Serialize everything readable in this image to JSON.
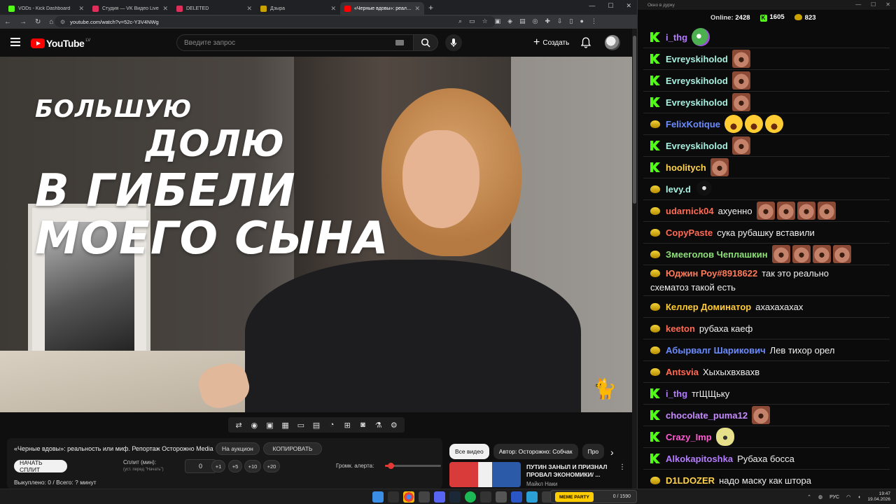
{
  "browser": {
    "tabs": [
      {
        "title": "VODs - Kick Dashboard",
        "color": "#53fc18"
      },
      {
        "title": "Студия — VK Видео Live",
        "color": "#e02e5a"
      },
      {
        "title": "DELETED",
        "color": "#e02e5a"
      },
      {
        "title": "Дзыра",
        "color": "#c9a200"
      },
      {
        "title": "«Черные вдовы»: реальн...",
        "color": "#ff0000",
        "active": true
      }
    ],
    "url": "youtube.com/watch?v=52c-Y3V4NWg"
  },
  "youtube": {
    "logo_text": "YouTube",
    "country": "LV",
    "search_placeholder": "Введите запрос",
    "create_label": "Создать"
  },
  "video": {
    "overlay_lines": [
      "БОЛЬШУЮ",
      "ДОЛЮ",
      "В ГИБЕЛИ",
      "МОЕГО СЫНА"
    ]
  },
  "panel": {
    "video_title": "«Черные вдовы»: реальность или миф. Репортаж Осторожно Media",
    "auction_label": "На аукцион",
    "copy_label": "КОПИРОВАТЬ",
    "start_split_label": "НАЧАТЬ СПЛИТ",
    "split_label": "Сплит (мин):",
    "split_hint": "(уст. перед \"Начать\")",
    "split_value": "0",
    "increments": [
      "+1",
      "+5",
      "+10",
      "+20"
    ],
    "volume_label": "Громк. алерта:",
    "volume_level": 0.1,
    "status": "Выкуплено: 0 / Всего: ? минут"
  },
  "related": {
    "chips": [
      {
        "label": "Все видео",
        "active": true
      },
      {
        "label": "Автор: Осторожно: Собчак",
        "active": false
      },
      {
        "label": "Про",
        "active": false
      }
    ],
    "items": [
      {
        "title": "ПУТИН ЗАНЫЛ И ПРИЗНАЛ ПРОВАЛ ЭКОНОМИКИ/ ...",
        "channel": "Майкл Наки"
      }
    ]
  },
  "chat": {
    "window_title": "Окно в дурку",
    "online_label": "Online:",
    "online_count": "2428",
    "kick_count": "1605",
    "vk_count": "823",
    "messages": [
      {
        "platform": "kick",
        "nick": "i_thg",
        "color": "#b47cff",
        "text": "",
        "emotes": [
          "frog"
        ]
      },
      {
        "platform": "kick",
        "nick": "Evreyskiholod",
        "color": "#a8f0e0",
        "text": "",
        "emotes": [
          "face"
        ]
      },
      {
        "platform": "kick",
        "nick": "Evreyskiholod",
        "color": "#a8f0e0",
        "text": "",
        "emotes": [
          "face"
        ]
      },
      {
        "platform": "kick",
        "nick": "Evreyskiholod",
        "color": "#a8f0e0",
        "text": "",
        "emotes": [
          "face"
        ]
      },
      {
        "platform": "vk",
        "nick": "FelixKotique",
        "color": "#6a8cff",
        "text": "",
        "emotes": [
          "laugh",
          "laugh",
          "laugh"
        ]
      },
      {
        "platform": "kick",
        "nick": "Evreyskiholod",
        "color": "#a8f0e0",
        "text": "",
        "emotes": [
          "face"
        ]
      },
      {
        "platform": "kick",
        "nick": "hoolitych",
        "color": "#ffd24d",
        "text": "",
        "emotes": [
          "face"
        ]
      },
      {
        "platform": "vk",
        "nick": "levy.d",
        "color": "#a8f0e0",
        "text": "",
        "emotes": [
          "cat"
        ]
      },
      {
        "platform": "vk",
        "nick": "udarnick04",
        "color": "#ff6a55",
        "text": "ахуенно",
        "emotes": [
          "face",
          "face",
          "face",
          "face"
        ]
      },
      {
        "platform": "vk",
        "nick": "CopyPaste",
        "color": "#ff6a55",
        "text": "сука рубашку вставили",
        "emotes": []
      },
      {
        "platform": "vk",
        "nick": "Змееголов Чеплашкин",
        "color": "#8fe07a",
        "text": "",
        "emotes": [
          "face",
          "face",
          "face",
          "face"
        ]
      },
      {
        "platform": "vk",
        "nick": "Юджин Роу#8918622",
        "color": "#ff7a5a",
        "text": "так это реально",
        "text2": "схематоз такой есть",
        "emotes": []
      },
      {
        "platform": "vk",
        "nick": "Келлер Доминатор",
        "color": "#ffcc33",
        "text": "ахахахахах",
        "emotes": []
      },
      {
        "platform": "vk",
        "nick": "keeton",
        "color": "#ff6a55",
        "text": "рубаха каеф",
        "emotes": []
      },
      {
        "platform": "vk",
        "nick": "Абырвалг Шарикович",
        "color": "#6a8cff",
        "text": "Лев тихор орел",
        "emotes": []
      },
      {
        "platform": "vk",
        "nick": "Antsvia",
        "color": "#ff6a55",
        "text": "Хыхыхвхвахв",
        "emotes": []
      },
      {
        "platform": "kick",
        "nick": "i_thg",
        "color": "#b47cff",
        "text": "тгЩЩьку",
        "emotes": []
      },
      {
        "platform": "kick",
        "nick": "chocolate_puma12",
        "color": "#c78cff",
        "text": "",
        "emotes": [
          "face"
        ]
      },
      {
        "platform": "kick",
        "nick": "Crazy_Imp",
        "color": "#ff5ad0",
        "text": "",
        "emotes": [
          "blob"
        ]
      },
      {
        "platform": "kick",
        "nick": "Alkokapitoshka",
        "color": "#b47cff",
        "text": "Рубаха босса",
        "emotes": []
      },
      {
        "platform": "vk",
        "nick": "D1LDOZER",
        "color": "#ffd24d",
        "text": "надо маску как штора",
        "emotes": []
      }
    ]
  },
  "taskbar": {
    "widget_label": "MEME PARTY",
    "widget_count": "0 / 1590",
    "lang": "РУС",
    "time": "19:47",
    "date": "19.04.2026"
  }
}
